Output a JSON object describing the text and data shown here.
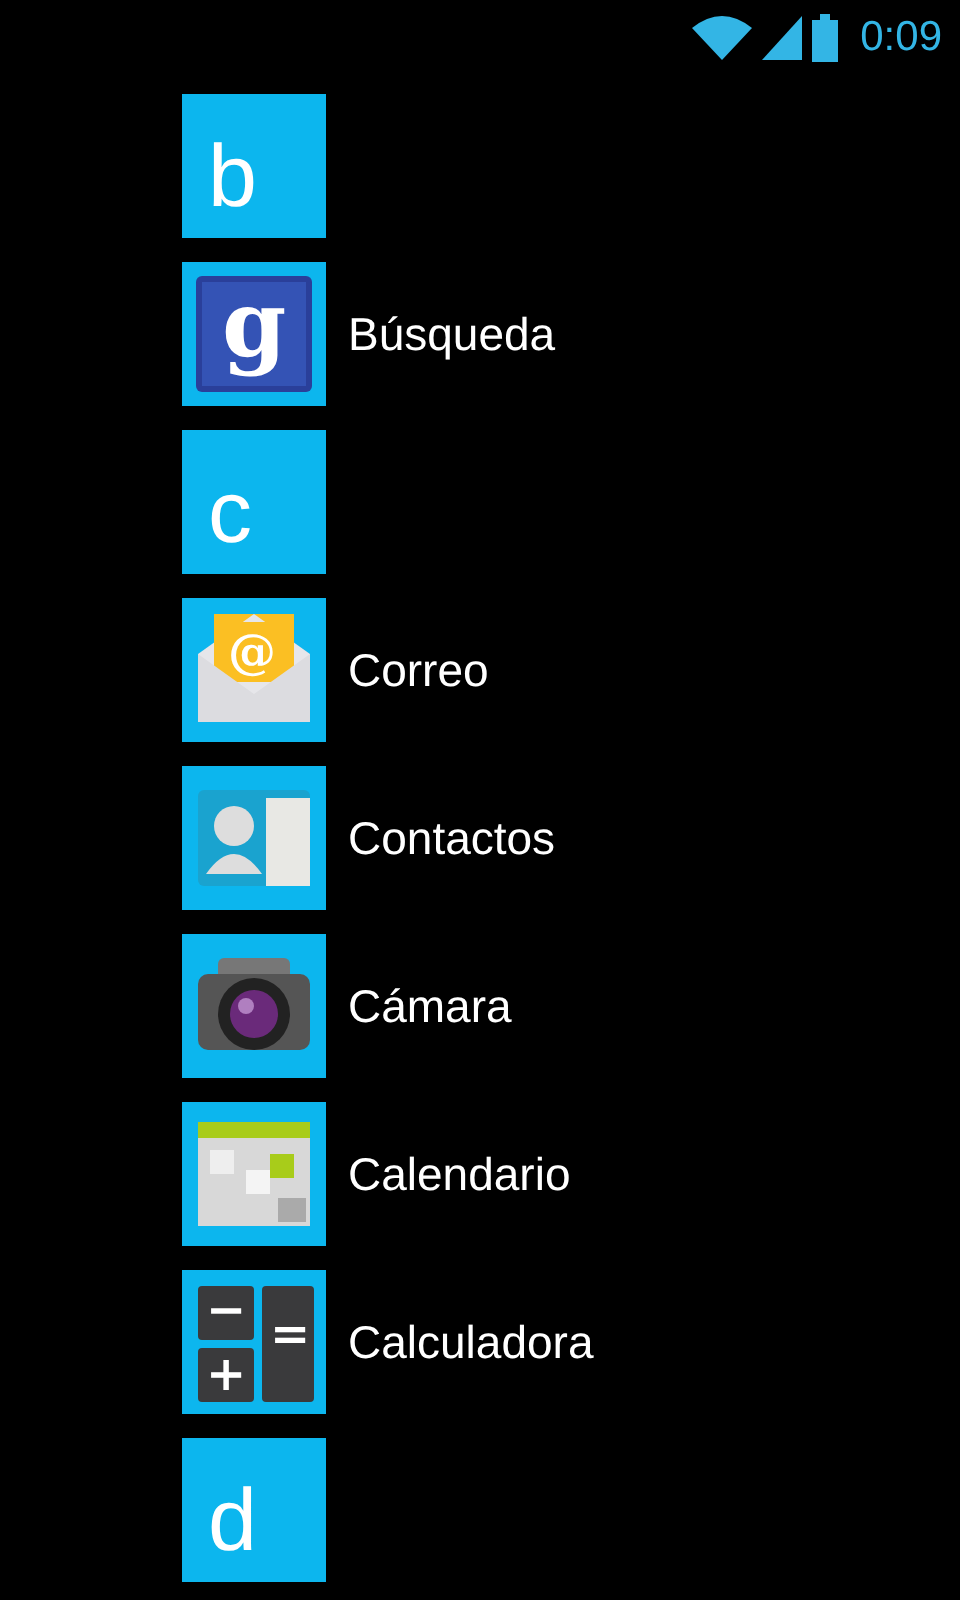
{
  "status_bar": {
    "time": "0:09"
  },
  "items": [
    {
      "kind": "header",
      "label": "b"
    },
    {
      "kind": "app",
      "glyph": "g",
      "label": "Búsqueda"
    },
    {
      "kind": "header",
      "label": "c"
    },
    {
      "kind": "app",
      "glyph": "@",
      "label": "Correo"
    },
    {
      "kind": "app",
      "label": "Contactos"
    },
    {
      "kind": "app",
      "label": "Cámara"
    },
    {
      "kind": "app",
      "label": "Calendario"
    },
    {
      "kind": "app",
      "glyphs": [
        "−",
        "+",
        "="
      ],
      "label": "Calculadora"
    },
    {
      "kind": "header",
      "label": "d"
    }
  ]
}
